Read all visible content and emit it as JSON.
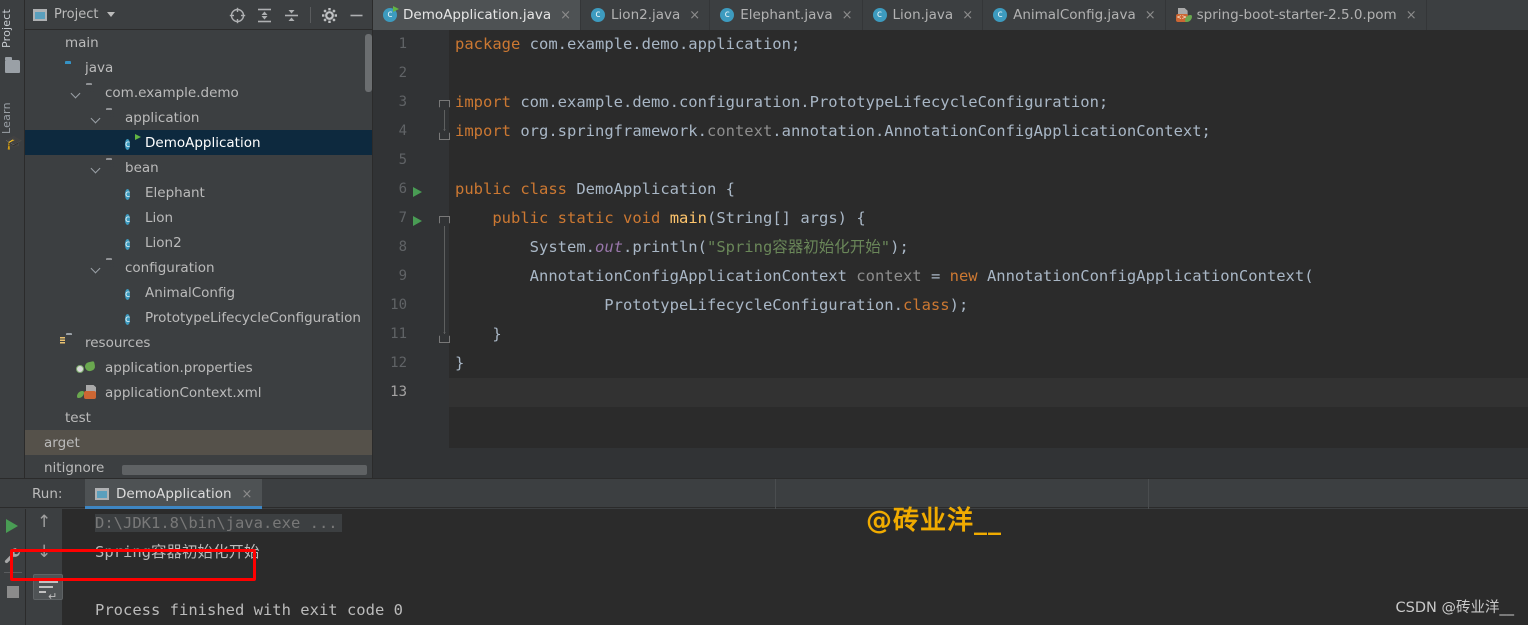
{
  "toolstrip": {
    "tabs": [
      {
        "label": "Project",
        "icon": "project-icon"
      },
      {
        "label": "Learn",
        "icon": "graduation-cap-icon"
      }
    ]
  },
  "project_panel": {
    "title": "Project",
    "toolbar": [
      {
        "name": "locate-icon",
        "glyph": "⊕"
      },
      {
        "name": "expand-all-icon",
        "glyph": "⇳"
      },
      {
        "name": "collapse-all-icon",
        "glyph": "⇱"
      },
      {
        "name": "settings-gear-icon",
        "glyph": "⚙"
      },
      {
        "name": "hide-icon",
        "glyph": "—"
      }
    ],
    "tree": [
      {
        "label": "main",
        "icon": "module-icon",
        "indent": 0,
        "arrow": false,
        "state": "normal"
      },
      {
        "label": "java",
        "icon": "source-folder-icon",
        "indent": 1,
        "arrow": false,
        "state": "normal"
      },
      {
        "label": "com.example.demo",
        "icon": "package-icon",
        "indent": 2,
        "arrow": true,
        "state": "normal"
      },
      {
        "label": "application",
        "icon": "package-icon",
        "indent": 3,
        "arrow": true,
        "state": "normal"
      },
      {
        "label": "DemoApplication",
        "icon": "runnable-class-icon",
        "indent": 4,
        "arrow": false,
        "state": "selected"
      },
      {
        "label": "bean",
        "icon": "package-icon",
        "indent": 3,
        "arrow": true,
        "state": "normal"
      },
      {
        "label": "Elephant",
        "icon": "class-icon",
        "indent": 4,
        "arrow": false,
        "state": "normal"
      },
      {
        "label": "Lion",
        "icon": "class-icon",
        "indent": 4,
        "arrow": false,
        "state": "normal"
      },
      {
        "label": "Lion2",
        "icon": "class-icon",
        "indent": 4,
        "arrow": false,
        "state": "normal"
      },
      {
        "label": "configuration",
        "icon": "package-icon",
        "indent": 3,
        "arrow": true,
        "state": "normal"
      },
      {
        "label": "AnimalConfig",
        "icon": "class-icon",
        "indent": 4,
        "arrow": false,
        "state": "normal"
      },
      {
        "label": "PrototypeLifecycleConfiguration",
        "icon": "class-icon",
        "indent": 4,
        "arrow": false,
        "state": "normal"
      },
      {
        "label": "resources",
        "icon": "resource-folder-icon",
        "indent": 1,
        "arrow": false,
        "state": "normal"
      },
      {
        "label": "application.properties",
        "icon": "spring-properties-icon",
        "indent": 2,
        "arrow": false,
        "state": "normal"
      },
      {
        "label": "applicationContext.xml",
        "icon": "spring-xml-icon",
        "indent": 2,
        "arrow": false,
        "state": "normal"
      },
      {
        "label": "test",
        "icon": "module-icon",
        "indent": 0,
        "arrow": false,
        "state": "normal"
      },
      {
        "label": "arget",
        "icon": "none",
        "indent": 0,
        "arrow": false,
        "state": "highlighted"
      },
      {
        "label": "nitignore",
        "icon": "none",
        "indent": 0,
        "arrow": false,
        "state": "normal"
      }
    ]
  },
  "editor_tabs": [
    {
      "label": "DemoApplication.java",
      "icon": "runnable-class-icon",
      "active": true,
      "close": "×"
    },
    {
      "label": "Lion2.java",
      "icon": "class-icon",
      "active": false,
      "close": "×"
    },
    {
      "label": "Elephant.java",
      "icon": "class-icon",
      "active": false,
      "close": "×"
    },
    {
      "label": "Lion.java",
      "icon": "class-icon",
      "active": false,
      "close": "×"
    },
    {
      "label": "AnimalConfig.java",
      "icon": "class-icon",
      "active": false,
      "close": "×"
    },
    {
      "label": "spring-boot-starter-2.5.0.pom",
      "icon": "spring-xml-icon",
      "active": false,
      "close": "×"
    }
  ],
  "editor": {
    "line_numbers": [
      "1",
      "2",
      "3",
      "4",
      "5",
      "6",
      "7",
      "8",
      "9",
      "10",
      "11",
      "12",
      "13"
    ],
    "current_line": 13,
    "run_markers": [
      6,
      7
    ],
    "code_lines": [
      {
        "n": 1,
        "text": "package com.example.demo.application;"
      },
      {
        "n": 2,
        "text": ""
      },
      {
        "n": 3,
        "text": "import com.example.demo.configuration.PrototypeLifecycleConfiguration;"
      },
      {
        "n": 4,
        "text": "import org.springframework.context.annotation.AnnotationConfigApplicationContext;"
      },
      {
        "n": 5,
        "text": ""
      },
      {
        "n": 6,
        "text": "public class DemoApplication {"
      },
      {
        "n": 7,
        "text": "    public static void main(String[] args) {"
      },
      {
        "n": 8,
        "text": "        System.out.println(\"Spring容器初始化开始\");"
      },
      {
        "n": 9,
        "text": "        AnnotationConfigApplicationContext context = new AnnotationConfigApplicationContext("
      },
      {
        "n": 10,
        "text": "                PrototypeLifecycleConfiguration.class);"
      },
      {
        "n": 11,
        "text": "    }"
      },
      {
        "n": 12,
        "text": "}"
      },
      {
        "n": 13,
        "text": ""
      }
    ]
  },
  "run_panel": {
    "label": "Run:",
    "tab": {
      "label": "DemoApplication",
      "close": "×",
      "icon": "run-config-icon"
    },
    "side_buttons": [
      {
        "name": "rerun-button",
        "glyph": "▶"
      },
      {
        "name": "edit-configurations-button",
        "glyph": "🔧"
      },
      {
        "name": "stop-button",
        "glyph": "■"
      },
      {
        "name": "up-arrow-button",
        "glyph": "↑"
      },
      {
        "name": "down-arrow-button",
        "glyph": "↓"
      },
      {
        "name": "soft-wrap-button",
        "glyph": "≡"
      }
    ],
    "console": [
      {
        "text": "D:\\JDK1.8\\bin\\java.exe ...",
        "style": "command"
      },
      {
        "text": "Spring容器初始化开始",
        "style": "output",
        "highlighted": true
      },
      {
        "text": "",
        "style": "output"
      },
      {
        "text": "Process finished with exit code 0",
        "style": "output"
      }
    ]
  },
  "watermarks": {
    "main": "@砖业洋__",
    "footer": "CSDN @砖业洋__"
  },
  "colors": {
    "accent": "#3e86c3",
    "selection": "#0d293e",
    "editor_bg": "#2b2b2b",
    "panel_bg": "#3c3f41",
    "keyword": "#cc7832",
    "string": "#6a8759",
    "highlight_box": "#ff0000",
    "watermark": "#f0ab00"
  }
}
